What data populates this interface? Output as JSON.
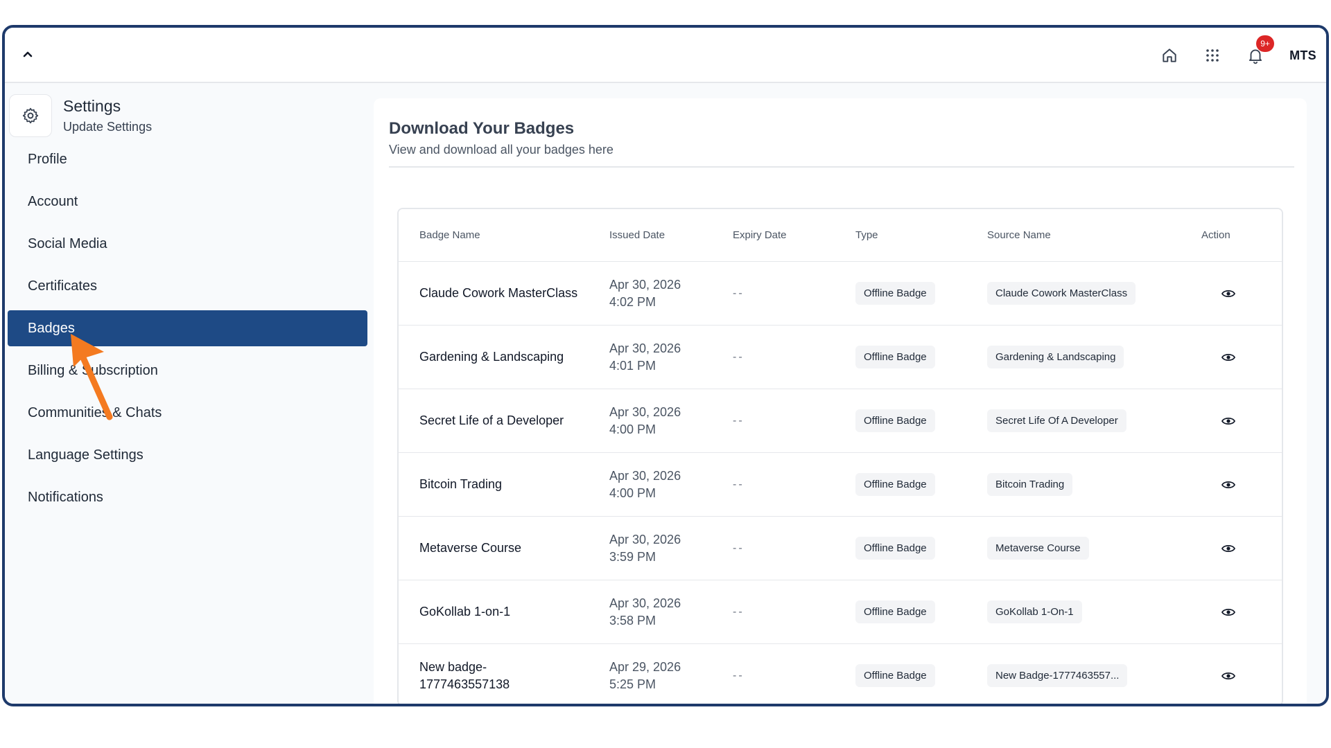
{
  "topbar": {
    "collapse_icon": "chevron-up-icon",
    "notification_count": "9+",
    "user_initials": "MTS"
  },
  "sidebar": {
    "title": "Settings",
    "subtitle": "Update Settings",
    "items": [
      {
        "label": "Profile"
      },
      {
        "label": "Account"
      },
      {
        "label": "Social Media"
      },
      {
        "label": "Certificates"
      },
      {
        "label": "Badges"
      },
      {
        "label": "Billing & Subscription"
      },
      {
        "label": "Communities & Chats"
      },
      {
        "label": "Language Settings"
      },
      {
        "label": "Notifications"
      }
    ],
    "active_item": "Badges"
  },
  "main": {
    "title": "Download Your Badges",
    "subtitle": "View and download all your badges here",
    "table": {
      "headers": [
        "Badge Name",
        "Issued Date",
        "Expiry Date",
        "Type",
        "Source Name",
        "Action"
      ],
      "rows": [
        {
          "name_line1": "Claude Cowork MasterClass",
          "name_line2": "",
          "date": "Apr 30, 2026",
          "time": "4:02 PM",
          "expiry": "--",
          "type": "Offline Badge",
          "source": "Claude Cowork MasterClass"
        },
        {
          "name_line1": "Gardening & Landscaping",
          "name_line2": "",
          "date": "Apr 30, 2026",
          "time": "4:01 PM",
          "expiry": "--",
          "type": "Offline Badge",
          "source": "Gardening & Landscaping"
        },
        {
          "name_line1": "Secret Life of a Developer",
          "name_line2": "",
          "date": "Apr 30, 2026",
          "time": "4:00 PM",
          "expiry": "--",
          "type": "Offline Badge",
          "source": "Secret Life Of A Developer"
        },
        {
          "name_line1": "Bitcoin Trading",
          "name_line2": "",
          "date": "Apr 30, 2026",
          "time": "4:00 PM",
          "expiry": "--",
          "type": "Offline Badge",
          "source": "Bitcoin Trading"
        },
        {
          "name_line1": "Metaverse Course",
          "name_line2": "",
          "date": "Apr 30, 2026",
          "time": "3:59 PM",
          "expiry": "--",
          "type": "Offline Badge",
          "source": "Metaverse Course"
        },
        {
          "name_line1": "GoKollab 1-on-1",
          "name_line2": "",
          "date": "Apr 30, 2026",
          "time": "3:58 PM",
          "expiry": "--",
          "type": "Offline Badge",
          "source": "GoKollab 1-On-1"
        },
        {
          "name_line1": "New badge-",
          "name_line2": "1777463557138",
          "date": "Apr 29, 2026",
          "time": "5:25 PM",
          "expiry": "--",
          "type": "Offline Badge",
          "source": "New Badge-1777463557..."
        }
      ]
    }
  },
  "colors": {
    "frame_border": "#1e3a6b",
    "active_nav": "#1e4a85",
    "notification_badge": "#dc2626",
    "annotation_arrow": "#f47a20"
  }
}
